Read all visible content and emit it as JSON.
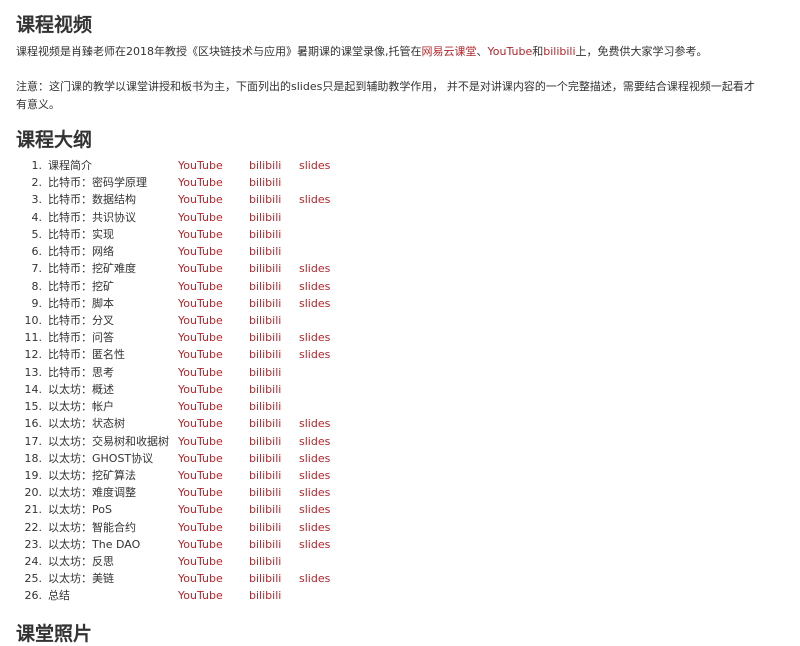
{
  "headings": {
    "video": "课程视频",
    "outline": "课程大纲",
    "photos": "课堂照片"
  },
  "intro": {
    "before": "课程视频是肖臻老师在2018年教授《区块链技术与应用》暑期课的课堂录像,托管在",
    "link1": "网易云课堂",
    "sep1": "、",
    "link2": "YouTube",
    "sep2": "和",
    "link3": "bilibili",
    "after": "上，免费供大家学习参考。"
  },
  "note": "注意：这门课的教学以课堂讲授和板书为主，下面列出的slides只是起到辅助教学作用， 并不是对讲课内容的一个完整描述，需要结合课程视频一起看才有意义。",
  "link_labels": {
    "youtube": "YouTube",
    "bilibili": "bilibili",
    "slides": "slides"
  },
  "lectures": [
    {
      "num": "1.",
      "title": "课程简介",
      "slides": true
    },
    {
      "num": "2.",
      "title": "比特币：密码学原理",
      "slides": false
    },
    {
      "num": "3.",
      "title": "比特币：数据结构",
      "slides": true
    },
    {
      "num": "4.",
      "title": "比特币：共识协议",
      "slides": false
    },
    {
      "num": "5.",
      "title": "比特币：实现",
      "slides": false
    },
    {
      "num": "6.",
      "title": "比特币：网络",
      "slides": false
    },
    {
      "num": "7.",
      "title": "比特币：挖矿难度",
      "slides": true
    },
    {
      "num": "8.",
      "title": "比特币：挖矿",
      "slides": true
    },
    {
      "num": "9.",
      "title": "比特币：脚本",
      "slides": true
    },
    {
      "num": "10.",
      "title": "比特币：分叉",
      "slides": false
    },
    {
      "num": "11.",
      "title": "比特币：问答",
      "slides": true
    },
    {
      "num": "12.",
      "title": "比特币：匿名性",
      "slides": true
    },
    {
      "num": "13.",
      "title": "比特币：思考",
      "slides": false
    },
    {
      "num": "14.",
      "title": "以太坊：概述",
      "slides": false
    },
    {
      "num": "15.",
      "title": "以太坊：帐户",
      "slides": false
    },
    {
      "num": "16.",
      "title": "以太坊：状态树",
      "slides": true
    },
    {
      "num": "17.",
      "title": "以太坊：交易树和收据树",
      "slides": true
    },
    {
      "num": "18.",
      "title": "以太坊：GHOST协议",
      "slides": true
    },
    {
      "num": "19.",
      "title": "以太坊：挖矿算法",
      "slides": true
    },
    {
      "num": "20.",
      "title": "以太坊：难度调整",
      "slides": true
    },
    {
      "num": "21.",
      "title": "以太坊：PoS",
      "slides": true
    },
    {
      "num": "22.",
      "title": "以太坊：智能合约",
      "slides": true
    },
    {
      "num": "23.",
      "title": "以太坊：The DAO",
      "slides": true
    },
    {
      "num": "24.",
      "title": "以太坊：反思",
      "slides": false
    },
    {
      "num": "25.",
      "title": "以太坊：美链",
      "slides": true
    },
    {
      "num": "26.",
      "title": "总结",
      "slides": false
    }
  ]
}
